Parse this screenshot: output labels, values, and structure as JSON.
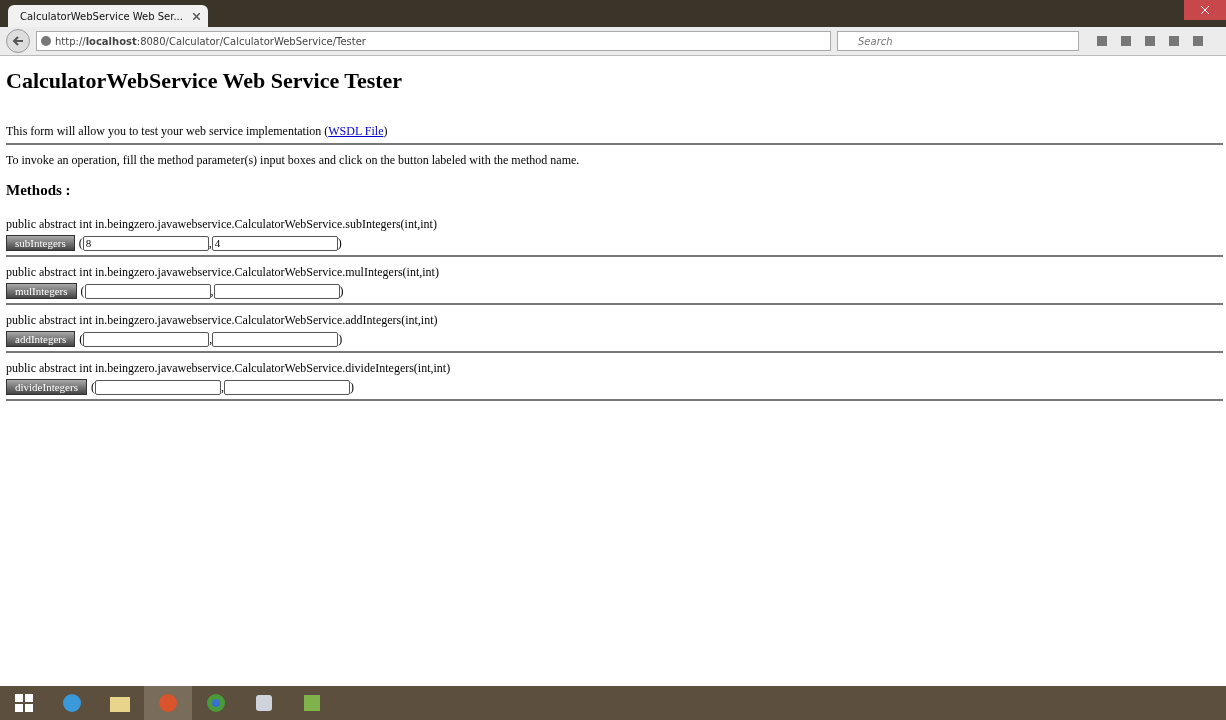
{
  "browser": {
    "tab_title": "CalculatorWebService Web Ser...",
    "url_prefix": "http://",
    "url_host": "localhost",
    "url_rest": ":8080/Calculator/CalculatorWebService/Tester",
    "search_placeholder": "Search"
  },
  "page": {
    "title": "CalculatorWebService Web Service Tester",
    "intro": "This form will allow you to test your web service implementation (",
    "intro_link": "WSDL File",
    "intro_end": ")",
    "instructions": "To invoke an operation, fill the method parameter(s) input boxes and click on the button labeled with the method name.",
    "methods_heading": "Methods :"
  },
  "methods": [
    {
      "signature": "public abstract int in.beingzero.javawebservice.CalculatorWebService.subIntegers(int,int)",
      "button": "subIntegers",
      "args": [
        "8",
        "4"
      ]
    },
    {
      "signature": "public abstract int in.beingzero.javawebservice.CalculatorWebService.mulIntegers(int,int)",
      "button": "mulIntegers"
    },
    {
      "signature": "public abstract int in.beingzero.javawebservice.CalculatorWebService.addIntegers(int,int)",
      "button": "addIntegers"
    },
    {
      "signature": "public abstract int in.beingzero.javawebservice.CalculatorWebService.divideIntegers(int,int)",
      "button": "divideIntegers"
    }
  ],
  "punct": {
    "open": "(",
    "comma": ",",
    "close": ")"
  }
}
